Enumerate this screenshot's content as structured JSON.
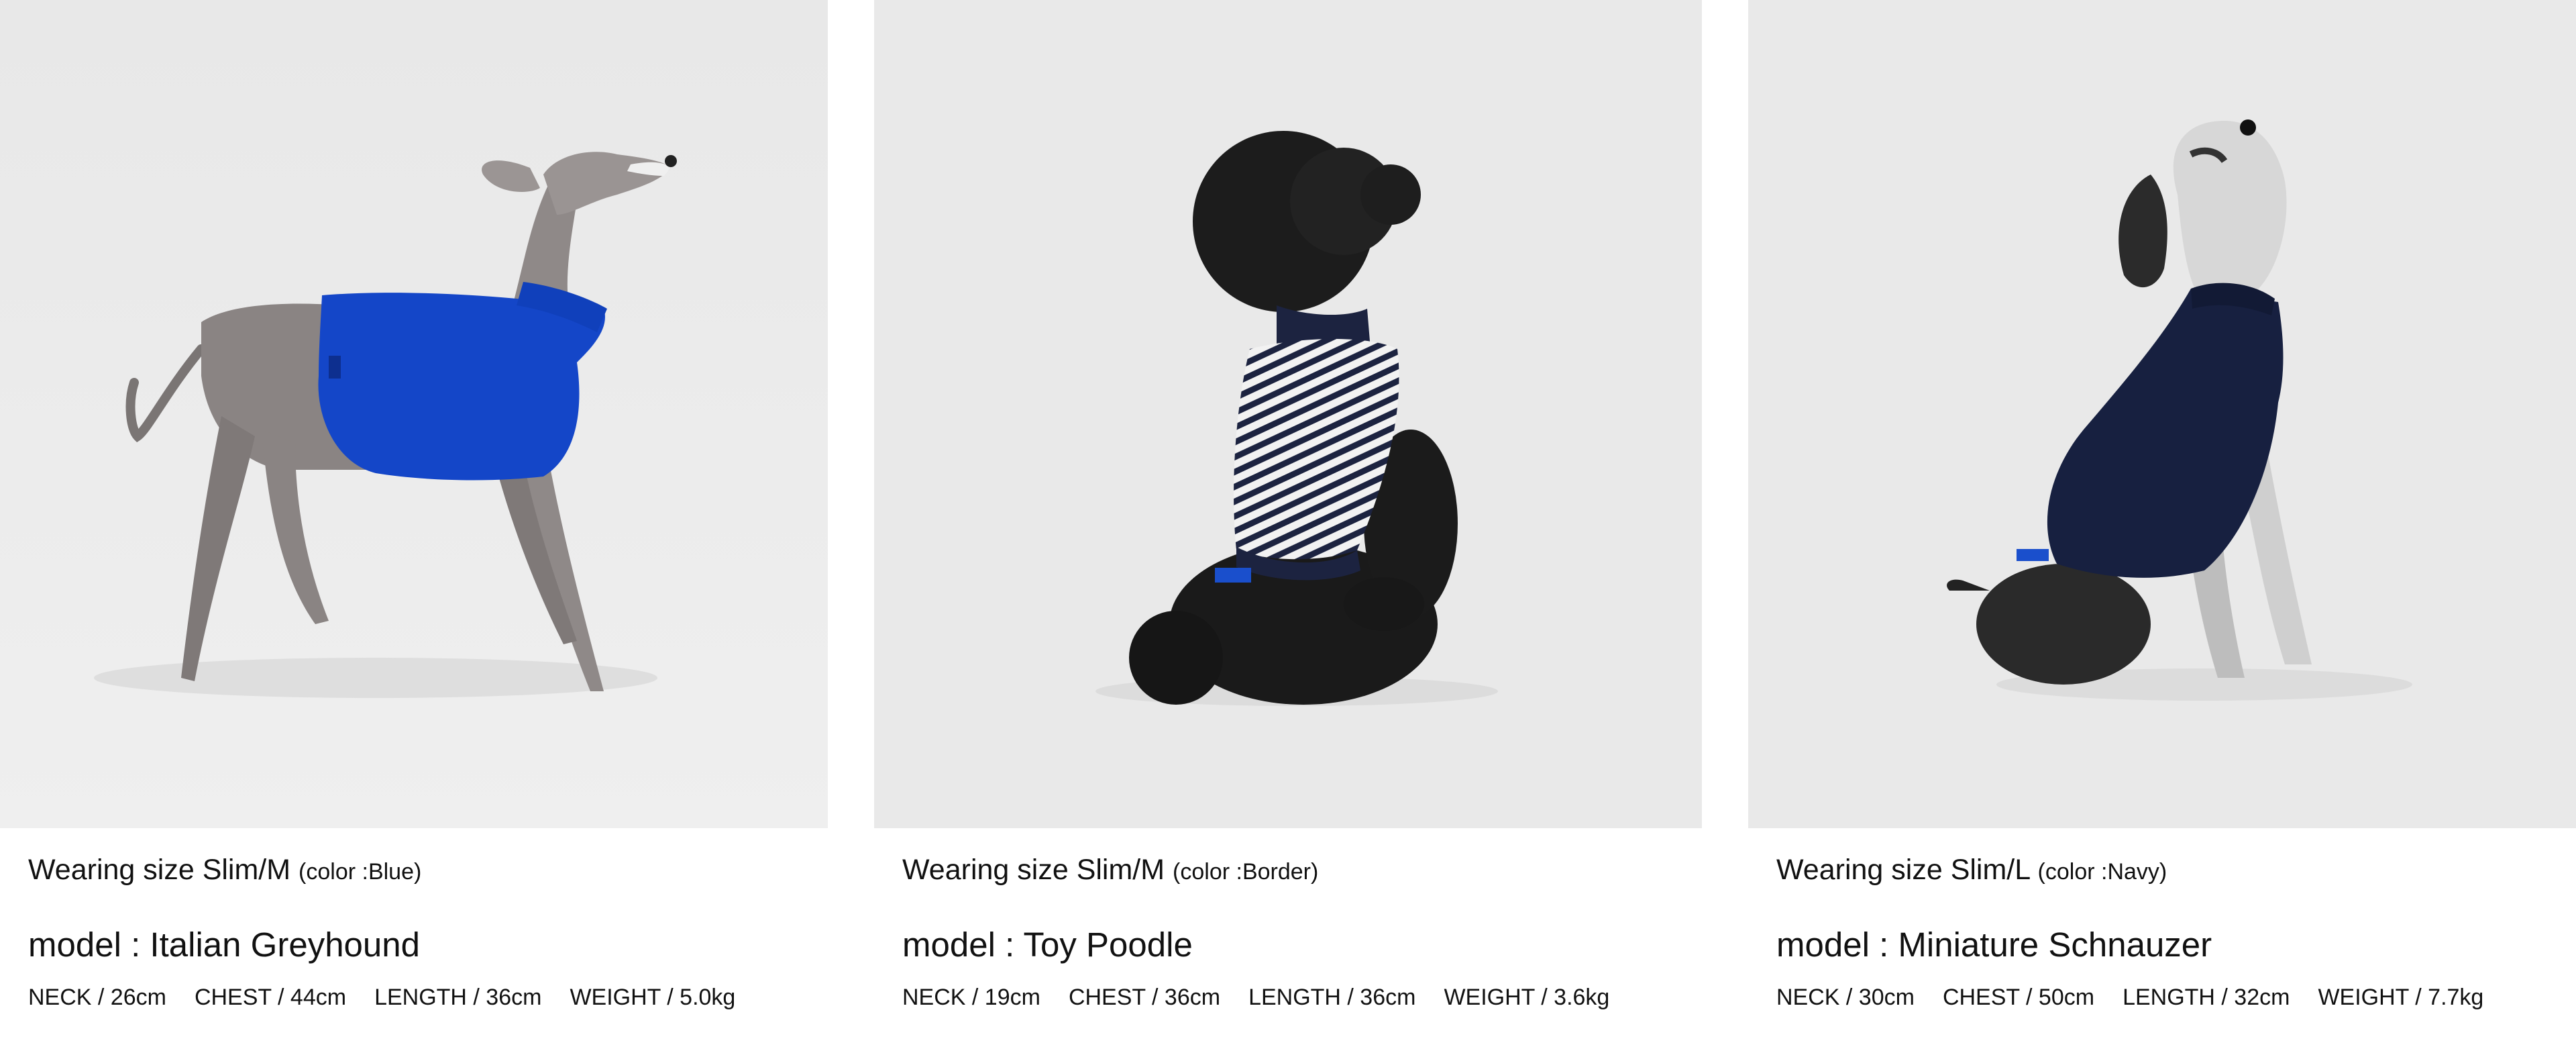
{
  "cards": [
    {
      "wearing": "Wearing size Slim/M",
      "color": "(color :Blue)",
      "model": "model : Italian Greyhound",
      "neck": "NECK / 26cm",
      "chest": "CHEST / 44cm",
      "length": "LENGTH / 36cm",
      "weight": "WEIGHT / 5.0kg",
      "garment_color": "#1446c8"
    },
    {
      "wearing": "Wearing size Slim/M",
      "color": "(color :Border)",
      "model": "model : Toy Poodle",
      "neck": "NECK / 19cm",
      "chest": "CHEST / 36cm",
      "length": "LENGTH / 36cm",
      "weight": "WEIGHT / 3.6kg",
      "garment_color": "#1c2340"
    },
    {
      "wearing": "Wearing size Slim/L",
      "color": "(color :Navy)",
      "model": "model : Miniature Schnauzer",
      "neck": "NECK / 30cm",
      "chest": "CHEST / 50cm",
      "length": "LENGTH / 32cm",
      "weight": "WEIGHT / 7.7kg",
      "garment_color": "#172040"
    }
  ]
}
